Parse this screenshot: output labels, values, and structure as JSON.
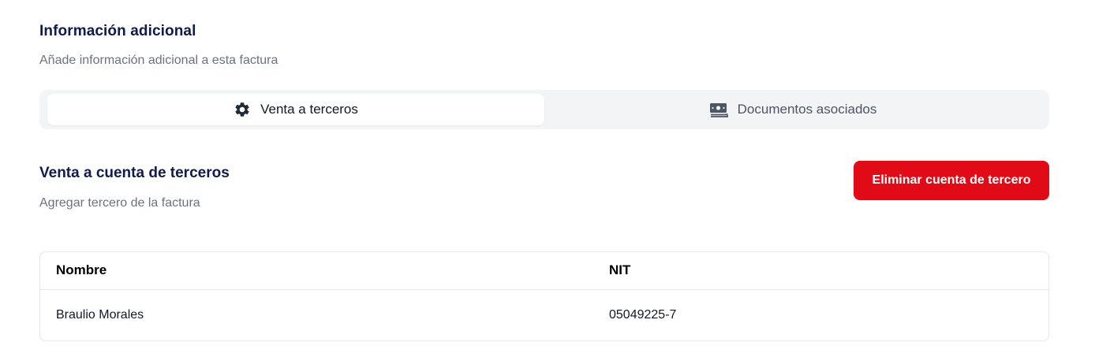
{
  "header": {
    "title": "Información adicional",
    "subtitle": "Añade información adicional a esta factura"
  },
  "tabs": [
    {
      "label": "Venta a terceros",
      "icon": "gear-icon",
      "active": true
    },
    {
      "label": "Documentos asociados",
      "icon": "money-icon",
      "active": false
    }
  ],
  "third_party": {
    "title": "Venta a cuenta de terceros",
    "subtitle": "Agregar tercero de la factura",
    "remove_label": "Eliminar cuenta de tercero"
  },
  "table": {
    "columns": [
      "Nombre",
      "NIT"
    ],
    "rows": [
      [
        "Braulio Morales",
        "05049225-7"
      ]
    ]
  },
  "colors": {
    "title": "#0f1b4c",
    "danger": "#e00b16",
    "tab_bg": "#f3f4f6"
  }
}
